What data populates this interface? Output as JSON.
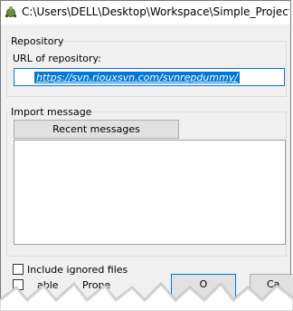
{
  "window": {
    "title": "C:\\Users\\DELL\\Desktop\\Workspace\\Simple_Project ..."
  },
  "repository": {
    "group_label": "Repository",
    "url_label": "URL of repository:",
    "url_value": "https://svn.riouxsvn.com/svnrepdummy/"
  },
  "import_message": {
    "group_label": "Import message",
    "recent_messages_button": "Recent messages",
    "message_text": ""
  },
  "options": {
    "include_ignored_label": "Include ignored files",
    "include_ignored_checked": false,
    "second_checkbox_label_part1": "able",
    "second_checkbox_label_part2": "Prope",
    "second_checkbox_checked": false
  },
  "buttons": {
    "ok_partial": "O",
    "cancel_partial": "Ca"
  }
}
